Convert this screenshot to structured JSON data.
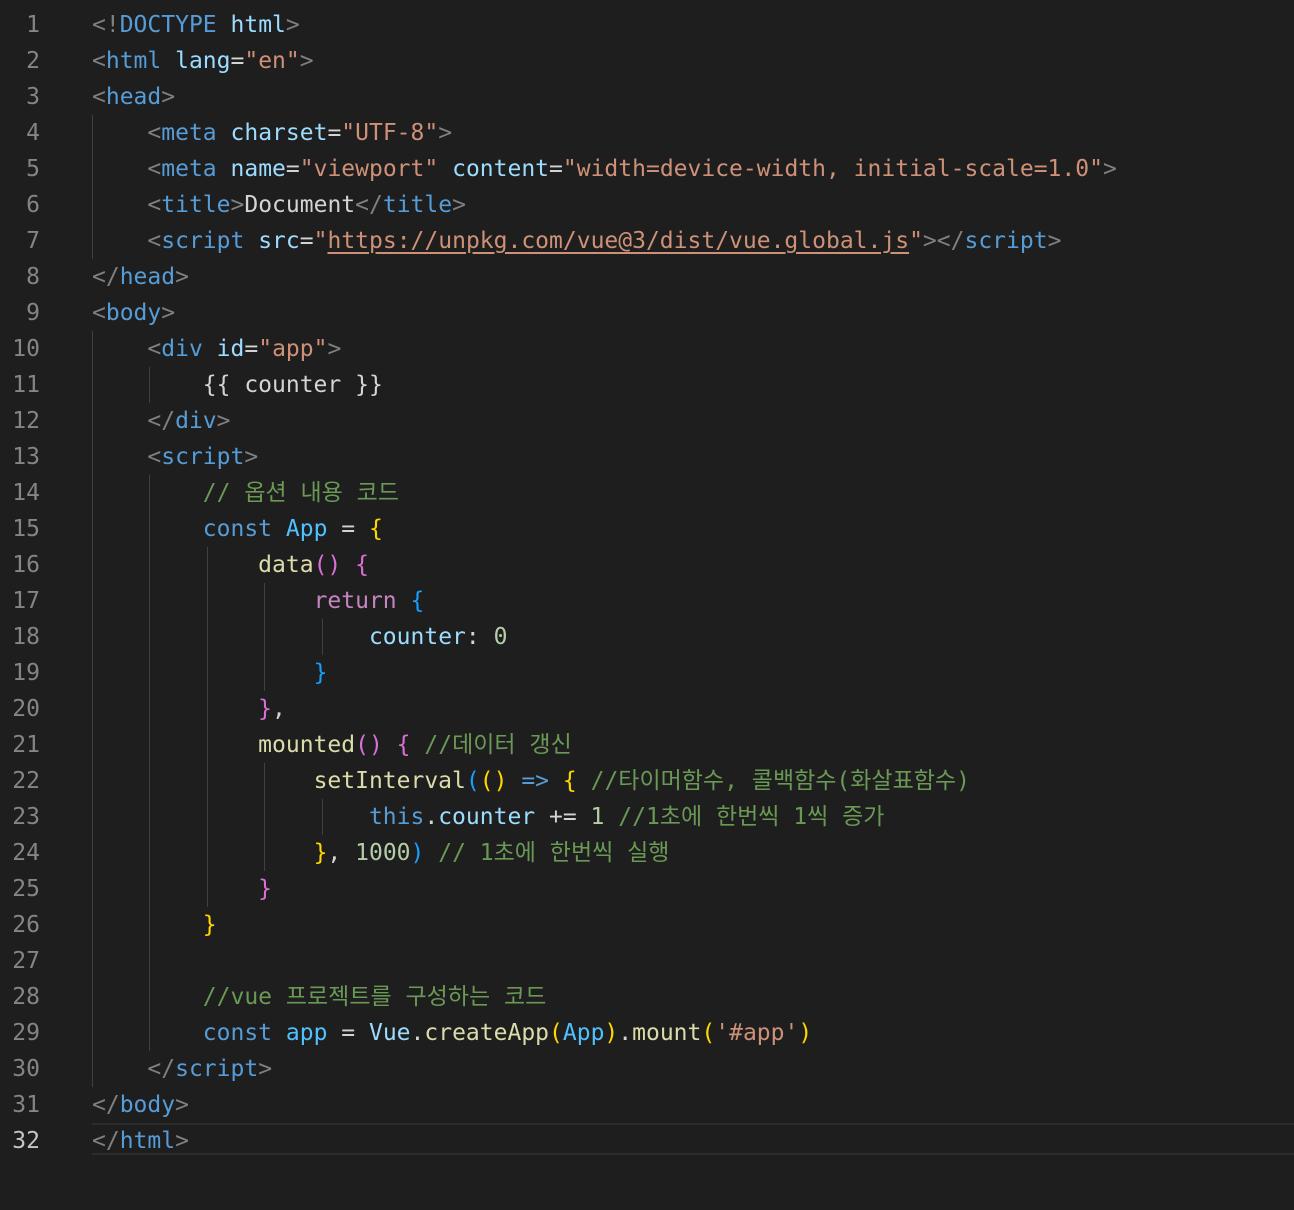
{
  "editor": {
    "active_line": 32,
    "colors": {
      "background": "#1e1e1e",
      "line_number": "#858585",
      "active_line_number": "#c6c6c6",
      "tag": "#569cd6",
      "attribute": "#9cdcfe",
      "string": "#ce9178",
      "comment": "#6a9955",
      "control_keyword": "#c586c0",
      "function": "#dcdcaa",
      "number": "#b5cea8",
      "bracket_level_1": "#ffd700",
      "bracket_level_2": "#da70d6",
      "bracket_level_3": "#179fff"
    },
    "lines": [
      {
        "n": "1",
        "tokens": [
          [
            "tag-bracket",
            "<!"
          ],
          [
            "tag",
            "DOCTYPE"
          ],
          [
            "text",
            " "
          ],
          [
            "attr",
            "html"
          ],
          [
            "tag-bracket",
            ">"
          ]
        ]
      },
      {
        "n": "2",
        "tokens": [
          [
            "tag-bracket",
            "<"
          ],
          [
            "tag",
            "html"
          ],
          [
            "text",
            " "
          ],
          [
            "attr",
            "lang"
          ],
          [
            "text",
            "="
          ],
          [
            "string",
            "\"en\""
          ],
          [
            "tag-bracket",
            ">"
          ]
        ]
      },
      {
        "n": "3",
        "tokens": [
          [
            "tag-bracket",
            "<"
          ],
          [
            "tag",
            "head"
          ],
          [
            "tag-bracket",
            ">"
          ]
        ]
      },
      {
        "n": "4",
        "tokens": [
          [
            "text",
            "    "
          ],
          [
            "tag-bracket",
            "<"
          ],
          [
            "tag",
            "meta"
          ],
          [
            "text",
            " "
          ],
          [
            "attr",
            "charset"
          ],
          [
            "text",
            "="
          ],
          [
            "string",
            "\"UTF-8\""
          ],
          [
            "tag-bracket",
            ">"
          ]
        ]
      },
      {
        "n": "5",
        "tokens": [
          [
            "text",
            "    "
          ],
          [
            "tag-bracket",
            "<"
          ],
          [
            "tag",
            "meta"
          ],
          [
            "text",
            " "
          ],
          [
            "attr",
            "name"
          ],
          [
            "text",
            "="
          ],
          [
            "string",
            "\"viewport\""
          ],
          [
            "text",
            " "
          ],
          [
            "attr",
            "content"
          ],
          [
            "text",
            "="
          ],
          [
            "string",
            "\"width=device-width, initial-scale=1.0\""
          ],
          [
            "tag-bracket",
            ">"
          ]
        ]
      },
      {
        "n": "6",
        "tokens": [
          [
            "text",
            "    "
          ],
          [
            "tag-bracket",
            "<"
          ],
          [
            "tag",
            "title"
          ],
          [
            "tag-bracket",
            ">"
          ],
          [
            "text",
            "Document"
          ],
          [
            "tag-bracket",
            "</"
          ],
          [
            "tag",
            "title"
          ],
          [
            "tag-bracket",
            ">"
          ]
        ]
      },
      {
        "n": "7",
        "tokens": [
          [
            "text",
            "    "
          ],
          [
            "tag-bracket",
            "<"
          ],
          [
            "tag",
            "script"
          ],
          [
            "text",
            " "
          ],
          [
            "attr",
            "src"
          ],
          [
            "text",
            "="
          ],
          [
            "string",
            "\""
          ],
          [
            "link",
            "https://unpkg.com/vue@3/dist/vue.global.js"
          ],
          [
            "string",
            "\""
          ],
          [
            "tag-bracket",
            "></"
          ],
          [
            "tag",
            "script"
          ],
          [
            "tag-bracket",
            ">"
          ]
        ]
      },
      {
        "n": "8",
        "tokens": [
          [
            "tag-bracket",
            "</"
          ],
          [
            "tag",
            "head"
          ],
          [
            "tag-bracket",
            ">"
          ]
        ]
      },
      {
        "n": "9",
        "tokens": [
          [
            "tag-bracket",
            "<"
          ],
          [
            "tag",
            "body"
          ],
          [
            "tag-bracket",
            ">"
          ]
        ]
      },
      {
        "n": "10",
        "tokens": [
          [
            "text",
            "    "
          ],
          [
            "tag-bracket",
            "<"
          ],
          [
            "tag",
            "div"
          ],
          [
            "text",
            " "
          ],
          [
            "attr",
            "id"
          ],
          [
            "text",
            "="
          ],
          [
            "string",
            "\"app\""
          ],
          [
            "tag-bracket",
            ">"
          ]
        ]
      },
      {
        "n": "11",
        "tokens": [
          [
            "text",
            "        {{ counter }}"
          ]
        ]
      },
      {
        "n": "12",
        "tokens": [
          [
            "text",
            "    "
          ],
          [
            "tag-bracket",
            "</"
          ],
          [
            "tag",
            "div"
          ],
          [
            "tag-bracket",
            ">"
          ]
        ]
      },
      {
        "n": "13",
        "tokens": [
          [
            "text",
            "    "
          ],
          [
            "tag-bracket",
            "<"
          ],
          [
            "tag",
            "script"
          ],
          [
            "tag-bracket",
            ">"
          ]
        ]
      },
      {
        "n": "14",
        "tokens": [
          [
            "text",
            "        "
          ],
          [
            "comment",
            "// 옵션 내용 코드"
          ]
        ]
      },
      {
        "n": "15",
        "tokens": [
          [
            "text",
            "        "
          ],
          [
            "keyword",
            "const"
          ],
          [
            "text",
            " "
          ],
          [
            "const",
            "App"
          ],
          [
            "text",
            " = "
          ],
          [
            "b1",
            "{"
          ]
        ]
      },
      {
        "n": "16",
        "tokens": [
          [
            "text",
            "            "
          ],
          [
            "func",
            "data"
          ],
          [
            "b2",
            "()"
          ],
          [
            "text",
            " "
          ],
          [
            "b2",
            "{"
          ]
        ]
      },
      {
        "n": "17",
        "tokens": [
          [
            "text",
            "                "
          ],
          [
            "control",
            "return"
          ],
          [
            "text",
            " "
          ],
          [
            "b3",
            "{"
          ]
        ]
      },
      {
        "n": "18",
        "tokens": [
          [
            "text",
            "                    "
          ],
          [
            "var",
            "counter"
          ],
          [
            "punct",
            ": "
          ],
          [
            "num",
            "0"
          ]
        ]
      },
      {
        "n": "19",
        "tokens": [
          [
            "text",
            "                "
          ],
          [
            "b3",
            "}"
          ]
        ]
      },
      {
        "n": "20",
        "tokens": [
          [
            "text",
            "            "
          ],
          [
            "b2",
            "}"
          ],
          [
            "punct",
            ","
          ]
        ]
      },
      {
        "n": "21",
        "tokens": [
          [
            "text",
            "            "
          ],
          [
            "func",
            "mounted"
          ],
          [
            "b2",
            "()"
          ],
          [
            "text",
            " "
          ],
          [
            "b2",
            "{"
          ],
          [
            "text",
            " "
          ],
          [
            "comment",
            "//데이터 갱신"
          ]
        ]
      },
      {
        "n": "22",
        "tokens": [
          [
            "text",
            "                "
          ],
          [
            "func",
            "setInterval"
          ],
          [
            "b3",
            "("
          ],
          [
            "b1",
            "()"
          ],
          [
            "text",
            " "
          ],
          [
            "keyword",
            "=>"
          ],
          [
            "text",
            " "
          ],
          [
            "b1",
            "{"
          ],
          [
            "text",
            " "
          ],
          [
            "comment",
            "//타이머함수, 콜백함수(화살표함수)"
          ]
        ]
      },
      {
        "n": "23",
        "tokens": [
          [
            "text",
            "                    "
          ],
          [
            "keyword",
            "this"
          ],
          [
            "punct",
            "."
          ],
          [
            "var",
            "counter"
          ],
          [
            "text",
            " += "
          ],
          [
            "num",
            "1"
          ],
          [
            "text",
            " "
          ],
          [
            "comment",
            "//1초에 한번씩 1씩 증가"
          ]
        ]
      },
      {
        "n": "24",
        "tokens": [
          [
            "text",
            "                "
          ],
          [
            "b1",
            "}"
          ],
          [
            "punct",
            ", "
          ],
          [
            "num",
            "1000"
          ],
          [
            "b3",
            ")"
          ],
          [
            "text",
            " "
          ],
          [
            "comment",
            "// 1초에 한번씩 실행"
          ]
        ]
      },
      {
        "n": "25",
        "tokens": [
          [
            "text",
            "            "
          ],
          [
            "b2",
            "}"
          ]
        ]
      },
      {
        "n": "26",
        "tokens": [
          [
            "text",
            "        "
          ],
          [
            "b1",
            "}"
          ]
        ]
      },
      {
        "n": "27",
        "tokens": []
      },
      {
        "n": "28",
        "tokens": [
          [
            "text",
            "        "
          ],
          [
            "comment",
            "//vue 프로젝트를 구성하는 코드"
          ]
        ]
      },
      {
        "n": "29",
        "tokens": [
          [
            "text",
            "        "
          ],
          [
            "keyword",
            "const"
          ],
          [
            "text",
            " "
          ],
          [
            "const",
            "app"
          ],
          [
            "text",
            " = "
          ],
          [
            "var",
            "Vue"
          ],
          [
            "punct",
            "."
          ],
          [
            "func",
            "createApp"
          ],
          [
            "b1",
            "("
          ],
          [
            "const",
            "App"
          ],
          [
            "b1",
            ")"
          ],
          [
            "punct",
            "."
          ],
          [
            "func",
            "mount"
          ],
          [
            "b1",
            "("
          ],
          [
            "string",
            "'#app'"
          ],
          [
            "b1",
            ")"
          ]
        ]
      },
      {
        "n": "30",
        "tokens": [
          [
            "text",
            "    "
          ],
          [
            "tag-bracket",
            "</"
          ],
          [
            "tag",
            "script"
          ],
          [
            "tag-bracket",
            ">"
          ]
        ]
      },
      {
        "n": "31",
        "tokens": [
          [
            "tag-bracket",
            "</"
          ],
          [
            "tag",
            "body"
          ],
          [
            "tag-bracket",
            ">"
          ]
        ]
      },
      {
        "n": "32",
        "tokens": [
          [
            "tag-bracket",
            "</"
          ],
          [
            "tag",
            "html"
          ],
          [
            "tag-bracket",
            ">"
          ]
        ]
      }
    ]
  }
}
